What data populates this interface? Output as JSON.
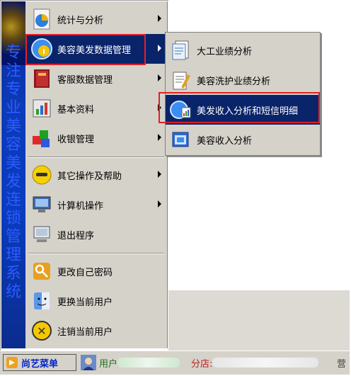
{
  "banner": {
    "text": "专注专业美容美发连锁管理系统"
  },
  "menu": {
    "items": [
      {
        "label": "统计与分析",
        "has_submenu": true,
        "icon": "pie-chart-icon"
      },
      {
        "label": "美容美发数据管理",
        "has_submenu": true,
        "icon": "globe-info-icon",
        "selected": true
      },
      {
        "label": "客服数据管理",
        "has_submenu": true,
        "icon": "book-icon"
      },
      {
        "label": "基本资料",
        "has_submenu": true,
        "icon": "gear-chart-icon"
      },
      {
        "label": "收银管理",
        "has_submenu": true,
        "icon": "blocks-icon"
      },
      {
        "label": "其它操作及帮助",
        "has_submenu": true,
        "icon": "smiley-icon"
      },
      {
        "label": "计算机操作",
        "has_submenu": true,
        "icon": "computer-icon"
      },
      {
        "label": "退出程序",
        "has_submenu": false,
        "icon": "monitor-exit-icon"
      },
      {
        "label": "更改自己密码",
        "has_submenu": false,
        "icon": "key-icon"
      },
      {
        "label": "更换当前用户",
        "has_submenu": false,
        "icon": "finder-face-icon"
      },
      {
        "label": "注销当前用户",
        "has_submenu": false,
        "icon": "logoff-icon"
      }
    ]
  },
  "submenu": {
    "items": [
      {
        "label": "大工业绩分析",
        "icon": "document-icon"
      },
      {
        "label": "美容洗护业绩分析",
        "icon": "document-pencil-icon"
      },
      {
        "label": "美发收入分析和短信明细",
        "icon": "globe-chart-icon",
        "selected": true
      },
      {
        "label": "美容收入分析",
        "icon": "window-icon"
      }
    ]
  },
  "taskbar": {
    "start_label": "尚艺菜单",
    "user_label": "用户",
    "store_label": "分店:",
    "right_label": "营"
  },
  "colors": {
    "selection": "#0a246a",
    "menu_bg": "#d5d2ca",
    "highlight": "#e0202a"
  }
}
